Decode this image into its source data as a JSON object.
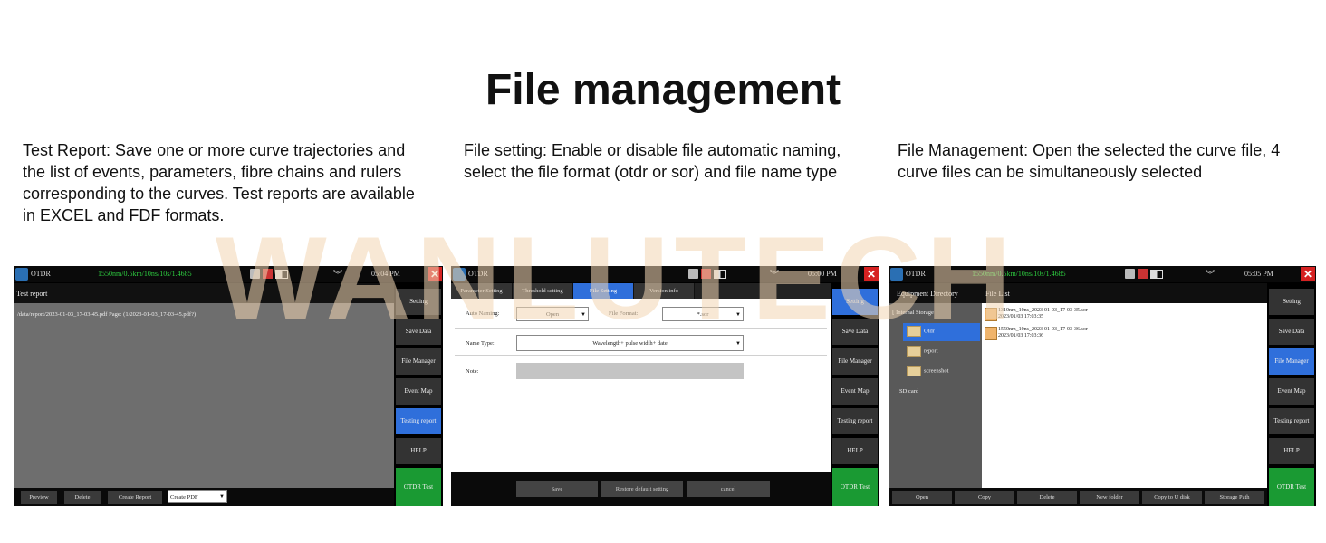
{
  "title": "File management",
  "watermark": "WANLUTECH",
  "descriptions": [
    "Test Report: Save one or more curve trajectories and the list of events, parameters, fibre chains and rulers corresponding to the curves. Test reports are available in EXCEL and FDF formats.",
    "File setting: Enable or disable file automatic naming, select the file format (otdr or sor) and file name type",
    "File Management: Open the selected the curve file, 4 curve files can be simultaneously selected"
  ],
  "sidebar_buttons": [
    "Setting",
    "Save Data",
    "File Manager",
    "Event Map",
    "Testing report",
    "HELP",
    "OTDR Test"
  ],
  "colors": {
    "accent_blue": "#2f6fdb",
    "test_green": "#1a9a33",
    "close_red": "#d62222",
    "param_green": "#2ecc40",
    "watermark": "#f3d7b4"
  },
  "icons": [
    "otdr-logo-icon",
    "usb-icon",
    "network-icon",
    "battery-icon",
    "chevron-down-icon",
    "close-icon",
    "folder-icon",
    "file-icon"
  ],
  "screen1": {
    "app_name": "OTDR",
    "params": "1550nm/0.5km/10ns/10s/1.4685",
    "time": "05:04 PM",
    "close": "✕",
    "header": "Test report",
    "report_path": "/data/report/2023-01-03_17-03-45.pdf Page: (1/2023-01-03_17-03-45.pdf?)",
    "buttons": [
      "Preview",
      "Delete",
      "Create Report"
    ],
    "select_value": "Create PDF"
  },
  "screen2": {
    "app_name": "OTDR",
    "time": "05:00 PM",
    "close": "✕",
    "tabs": [
      "Parameter Setting",
      "Threshold setting",
      "File Setting",
      "Version info"
    ],
    "auto_naming_label": "Auto Naming:",
    "auto_naming_value": "Open",
    "file_format_label": "File Format:",
    "file_format_value": "*.sor",
    "name_type_label": "Name Type:",
    "name_type_value": "Wavelength+ pulse width+ date",
    "note_label": "Note:",
    "buttons": [
      "Save",
      "Restore default setting",
      "cancel"
    ]
  },
  "screen3": {
    "app_name": "OTDR",
    "params": "1550nm/0.5km/10ns/10s/1.4685",
    "time": "05:05 PM",
    "close": "✕",
    "dir_header": "Equipment Directory",
    "list_header": "File List",
    "tree": [
      "Internal Storage",
      "Otdr",
      "report",
      "screenshot",
      "SD card"
    ],
    "files": [
      {
        "name": "1310nm_10ns_2023-01-03_17-03-35.sor",
        "date": "2023/01/03  17:03:35"
      },
      {
        "name": "1550nm_10ns_2023-01-03_17-03-36.sor",
        "date": "2023/01/03  17:03:36"
      }
    ],
    "buttons": [
      "Open",
      "Copy",
      "Delete",
      "New folder",
      "Copy to U disk",
      "Storage Path"
    ]
  }
}
